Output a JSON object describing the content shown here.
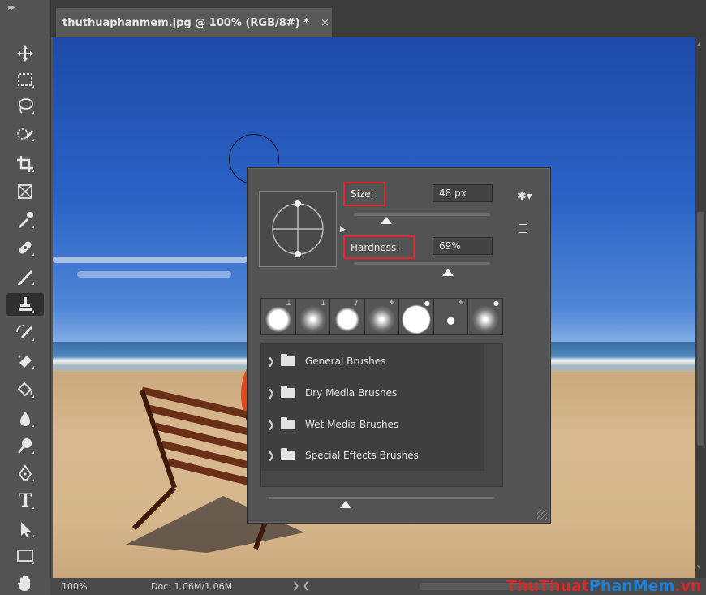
{
  "document": {
    "tab_title": "thuthuaphanmem.jpg @ 100% (RGB/8#) *",
    "close_glyph": "×"
  },
  "status": {
    "zoom": "100%",
    "doc": "Doc: 1.06M/1.06M",
    "arrows": "❯ ❮"
  },
  "watermark": {
    "part1": "ThuThuat",
    "part2": "PhanMem",
    "part3": ".vn"
  },
  "brush_popup": {
    "size_label": "Size:",
    "size_value": "48 px",
    "hardness_label": "Hardness:",
    "hardness_value": "69%",
    "size_slider_fraction": 0.24,
    "hardness_slider_fraction": 0.69,
    "presets_slider_fraction": 0.34,
    "groups": [
      {
        "label": "General Brushes"
      },
      {
        "label": "Dry Media Brushes"
      },
      {
        "label": "Wet Media Brushes"
      },
      {
        "label": "Special Effects Brushes"
      }
    ]
  },
  "toolbar": {
    "tools": [
      {
        "name": "move-tool",
        "icon": "move-icon"
      },
      {
        "name": "marquee-tool",
        "icon": "marquee-icon"
      },
      {
        "name": "lasso-tool",
        "icon": "lasso-icon"
      },
      {
        "name": "quick-selection-tool",
        "icon": "quick-selection-icon"
      },
      {
        "name": "crop-tool",
        "icon": "crop-icon"
      },
      {
        "name": "frame-tool",
        "icon": "frame-icon"
      },
      {
        "name": "eyedropper-tool",
        "icon": "eyedropper-icon"
      },
      {
        "name": "healing-brush-tool",
        "icon": "bandage-icon"
      },
      {
        "name": "brush-tool",
        "icon": "brush-icon"
      },
      {
        "name": "clone-stamp-tool",
        "icon": "stamp-icon"
      },
      {
        "name": "history-brush-tool",
        "icon": "history-brush-icon"
      },
      {
        "name": "eraser-tool",
        "icon": "eraser-icon"
      },
      {
        "name": "paint-bucket-tool",
        "icon": "bucket-icon"
      },
      {
        "name": "blur-tool",
        "icon": "drop-icon"
      },
      {
        "name": "dodge-tool",
        "icon": "dodge-icon"
      },
      {
        "name": "pen-tool",
        "icon": "pen-icon"
      },
      {
        "name": "type-tool",
        "icon": "type-icon",
        "glyph": "T"
      },
      {
        "name": "path-selection-tool",
        "icon": "arrow-icon"
      },
      {
        "name": "rectangle-tool",
        "icon": "rectangle-icon"
      },
      {
        "name": "hand-tool",
        "icon": "hand-icon"
      }
    ],
    "active_tool": "clone-stamp-tool"
  },
  "colors": {
    "highlight": "#e4252b",
    "panel": "#535353",
    "watermark_red": "#d42a2a",
    "watermark_blue": "#1e7fd6"
  }
}
